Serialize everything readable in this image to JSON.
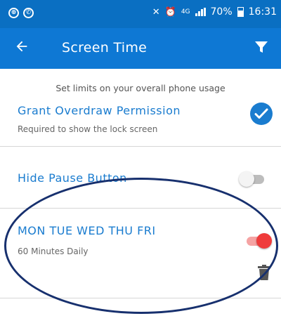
{
  "status_bar": {
    "battery": "70%",
    "time": "16:31",
    "network": "4G"
  },
  "app_bar": {
    "title": "Screen Time",
    "back_icon": "arrow-left-icon",
    "filter_icon": "filter-icon"
  },
  "subtitle": "Set limits on your overall phone usage",
  "overdraw": {
    "title": "Grant Overdraw Permission",
    "description": "Required to show the lock screen",
    "checked": true
  },
  "pause_button": {
    "title": "Hide Pause Button",
    "enabled": false
  },
  "schedule": {
    "days": "MON TUE WED THU FRI",
    "limit": "60 Minutes Daily",
    "enabled": true,
    "delete_icon": "trash-icon"
  },
  "colors": {
    "primary": "#0e78d4",
    "status_bar": "#0a6fc2",
    "accent_text": "#1a7ccf",
    "switch_on": "#ef3b3b",
    "annotation_oval": "#17306e"
  }
}
